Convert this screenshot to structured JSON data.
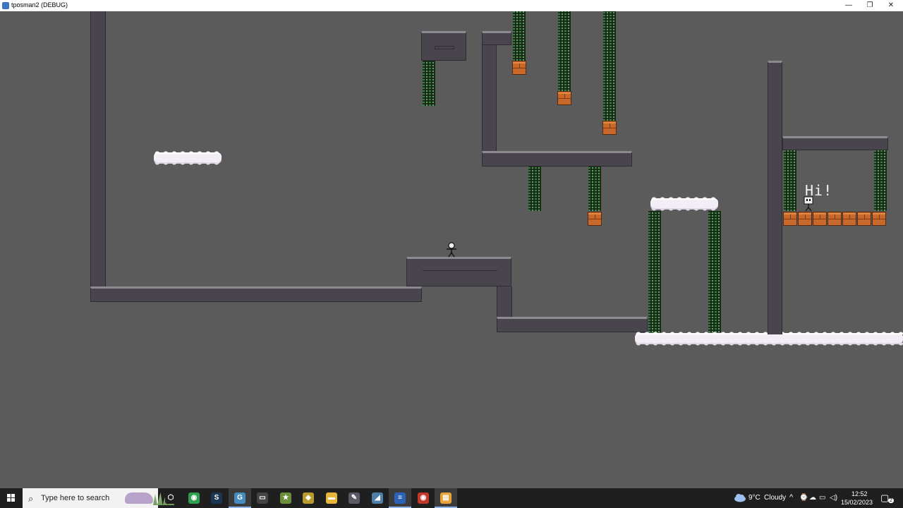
{
  "window": {
    "title": "tposman2 (DEBUG)",
    "minimize_glyph": "—",
    "restore_glyph": "❐",
    "close_glyph": "✕"
  },
  "game": {
    "speech_text": "Hi!"
  },
  "taskbar": {
    "search_placeholder": "Type here to search",
    "apps": [
      {
        "name": "task-view",
        "glyph": "⬡",
        "color": "#1f1f1f",
        "active": false
      },
      {
        "name": "chrome",
        "glyph": "◉",
        "color": "#2f9e4f",
        "active": false
      },
      {
        "name": "steam",
        "glyph": "S",
        "color": "#1b3552",
        "active": false
      },
      {
        "name": "godot",
        "glyph": "G",
        "color": "#478cbf",
        "active": true
      },
      {
        "name": "notes",
        "glyph": "▭",
        "color": "#444444",
        "active": false
      },
      {
        "name": "game-icon-1",
        "glyph": "★",
        "color": "#6a8f3a",
        "active": false
      },
      {
        "name": "game-icon-2",
        "glyph": "◆",
        "color": "#b89b2a",
        "active": false
      },
      {
        "name": "file-explorer",
        "glyph": "▬",
        "color": "#e7b53c",
        "active": false
      },
      {
        "name": "app-icon-9",
        "glyph": "✎",
        "color": "#5a5a66",
        "active": false
      },
      {
        "name": "app-icon-10",
        "glyph": "◢",
        "color": "#4d7fa8",
        "active": false
      },
      {
        "name": "app-icon-11",
        "glyph": "≡",
        "color": "#2a63b8",
        "active": true
      },
      {
        "name": "chrome-2",
        "glyph": "◉",
        "color": "#c0392b",
        "active": false
      },
      {
        "name": "app-icon-13",
        "glyph": "▤",
        "color": "#e8a23a",
        "active": true
      }
    ],
    "weather_temp": "9°C",
    "weather_desc": "Cloudy",
    "time": "12:52",
    "date": "15/02/2023",
    "notification_count": "2"
  }
}
